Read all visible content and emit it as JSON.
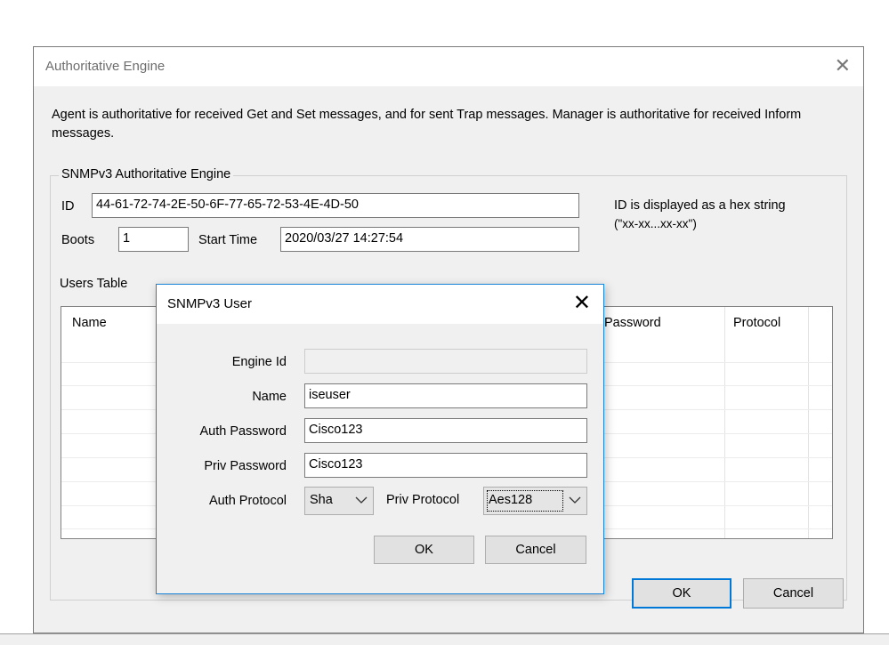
{
  "main_dialog": {
    "title": "Authoritative Engine",
    "description": "Agent is authoritative for received Get and Set messages, and for sent Trap messages. Manager is authoritative for received Inform messages.",
    "group_label": "SNMPv3 Authoritative Engine",
    "id_label": "ID",
    "id_value": "44-61-72-74-2E-50-6F-77-65-72-53-4E-4D-50",
    "id_note_line1": "ID is displayed as a hex string",
    "id_note_line2": "(\"xx-xx...xx-xx\")",
    "boots_label": "Boots",
    "boots_value": "1",
    "start_time_label": "Start Time",
    "start_time_value": "2020/03/27 14:27:54",
    "users_table_label": "Users Table",
    "users_table": {
      "columns": [
        "Name",
        "Password",
        "Protocol"
      ],
      "rows": []
    },
    "ok_label": "OK",
    "cancel_label": "Cancel"
  },
  "user_dialog": {
    "title": "SNMPv3 User",
    "engine_id_label": "Engine Id",
    "engine_id_value": "",
    "name_label": "Name",
    "name_value": "iseuser",
    "auth_password_label": "Auth Password",
    "auth_password_value": "Cisco123",
    "priv_password_label": "Priv Password",
    "priv_password_value": "Cisco123",
    "auth_protocol_label": "Auth Protocol",
    "auth_protocol_value": "Sha",
    "priv_protocol_label": "Priv Protocol",
    "priv_protocol_value": "Aes128",
    "ok_label": "OK",
    "cancel_label": "Cancel"
  },
  "icons": {
    "close": "close-icon",
    "dropdown": "chevron-down-icon"
  },
  "colors": {
    "accent": "#0078d7",
    "dialog_bg": "#f0f0f0"
  }
}
